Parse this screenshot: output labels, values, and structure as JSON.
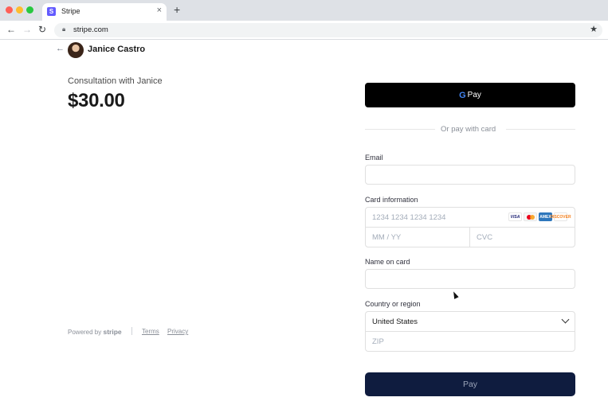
{
  "browser": {
    "tab_title": "Stripe",
    "tab_favicon": "S",
    "tab_close": "×",
    "new_tab": "+",
    "url": "stripe.com",
    "icons": [
      "back-icon",
      "forward-icon",
      "reload-icon",
      "lock-icon",
      "star-icon"
    ]
  },
  "merchant": {
    "back_icon": "←",
    "name": "Janice Castro",
    "product_name": "Consultation with Janice",
    "price": "$30.00"
  },
  "footer": {
    "powered_by": "Powered by",
    "brand": "stripe",
    "terms": "Terms",
    "privacy": "Privacy"
  },
  "payment": {
    "gpay_label": "Pay",
    "gpay_g": "G",
    "divider": "Or pay with card",
    "email_label": "Email",
    "email_value": "",
    "card_label": "Card information",
    "card_number_placeholder": "1234 1234 1234 1234",
    "card_exp_placeholder": "MM / YY",
    "card_cvc_placeholder": "CVC",
    "card_brands": {
      "visa": "VISA",
      "mastercard": "",
      "amex": "AMEX",
      "discover": "DISCOVER"
    },
    "name_label": "Name on card",
    "name_value": "",
    "country_label": "Country or region",
    "country_value": "United States",
    "zip_placeholder": "ZIP",
    "pay_button": "Pay"
  },
  "colors": {
    "gpay_bg": "#000000",
    "pay_button_bg": "#0f1c3f",
    "accent": "#635bff"
  }
}
